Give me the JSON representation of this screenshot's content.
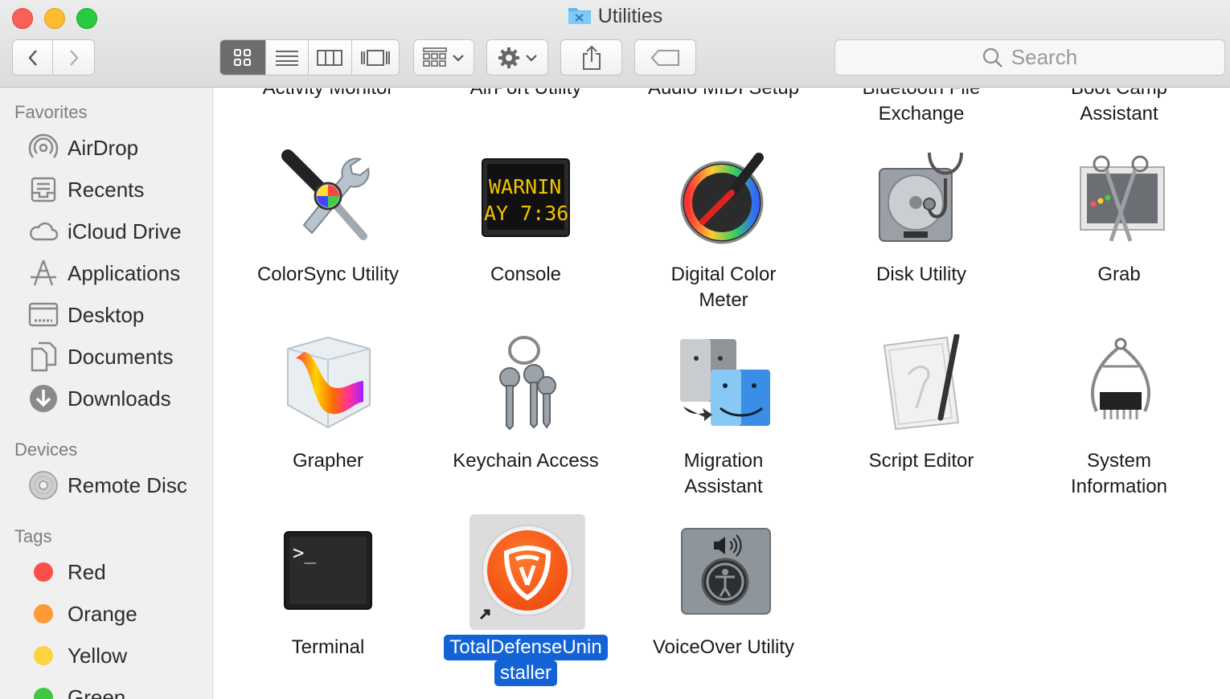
{
  "window": {
    "title": "Utilities"
  },
  "toolbar": {
    "search_placeholder": "Search"
  },
  "sidebar": {
    "favorites_header": "Favorites",
    "favorites": [
      {
        "label": "AirDrop",
        "icon": "airdrop-icon"
      },
      {
        "label": "Recents",
        "icon": "recents-icon"
      },
      {
        "label": "iCloud Drive",
        "icon": "cloud-icon"
      },
      {
        "label": "Applications",
        "icon": "applications-icon"
      },
      {
        "label": "Desktop",
        "icon": "desktop-icon"
      },
      {
        "label": "Documents",
        "icon": "documents-icon"
      },
      {
        "label": "Downloads",
        "icon": "downloads-icon"
      }
    ],
    "devices_header": "Devices",
    "devices": [
      {
        "label": "Remote Disc",
        "icon": "disc-icon"
      }
    ],
    "tags_header": "Tags",
    "tags": [
      {
        "label": "Red",
        "color": "#fc4f4b"
      },
      {
        "label": "Orange",
        "color": "#fd9a35"
      },
      {
        "label": "Yellow",
        "color": "#fcd440"
      },
      {
        "label": "Green",
        "color": "#40c844"
      }
    ]
  },
  "files": {
    "top_row_cut": [
      {
        "line1": "Activity Monitor",
        "line2": ""
      },
      {
        "line1": "AirPort Utility",
        "line2": ""
      },
      {
        "line1": "Audio MIDI Setup",
        "line2": ""
      },
      {
        "line1": "Bluetooth File",
        "line2": "Exchange"
      },
      {
        "line1": "Boot Camp",
        "line2": "Assistant"
      }
    ],
    "row2": [
      {
        "line1": "ColorSync Utility",
        "line2": ""
      },
      {
        "line1": "Console",
        "line2": ""
      },
      {
        "line1": "Digital Color",
        "line2": "Meter"
      },
      {
        "line1": "Disk Utility",
        "line2": ""
      },
      {
        "line1": "Grab",
        "line2": ""
      }
    ],
    "row3": [
      {
        "line1": "Grapher",
        "line2": ""
      },
      {
        "line1": "Keychain Access",
        "line2": ""
      },
      {
        "line1": "Migration",
        "line2": "Assistant"
      },
      {
        "line1": "Script Editor",
        "line2": ""
      },
      {
        "line1": "System",
        "line2": "Information"
      }
    ],
    "row4": [
      {
        "line1": "Terminal",
        "line2": ""
      },
      {
        "line1": "TotalDefenseUnin",
        "line2": "staller"
      },
      {
        "line1": "VoiceOver Utility",
        "line2": ""
      }
    ],
    "console_text": {
      "line1": "WARNIN",
      "line2": "AY 7:36"
    },
    "terminal_prompt": ">_",
    "selected_color": "#1463d6"
  }
}
